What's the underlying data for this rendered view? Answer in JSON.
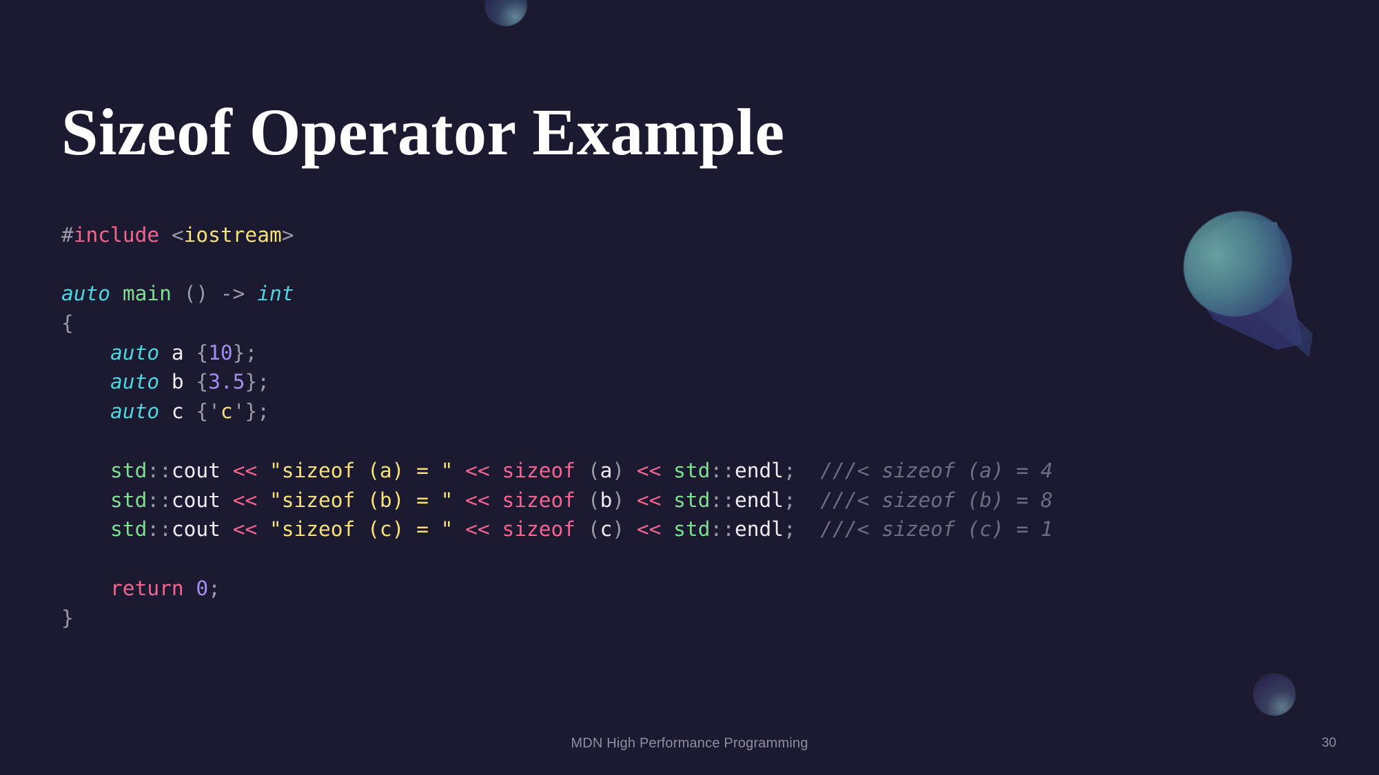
{
  "slide": {
    "title": "Sizeof Operator Example",
    "background_color": "#1c1a30",
    "footer": "MDN High Performance Programming",
    "page_number": "30"
  },
  "decorations": {
    "sphere_top": "sphere-decoration",
    "sphere_bottom": "sphere-decoration",
    "cone": "cone-decoration"
  },
  "code": {
    "language": "cpp",
    "lines": {
      "l1": {
        "hash": "#",
        "include": "include",
        "space": " ",
        "lt": "<",
        "header": "iostream",
        "gt": ">"
      },
      "l2_blank": "",
      "l3": {
        "auto": "auto",
        "sp1": " ",
        "main": "main",
        "sp2": " ",
        "parens": "()",
        "sp3": " ",
        "arrow": "->",
        "sp4": " ",
        "int": "int"
      },
      "l4": {
        "brace": "{"
      },
      "l5": {
        "indent": "    ",
        "auto": "auto",
        "sp1": " ",
        "name": "a",
        "sp2": " ",
        "open": "{",
        "value": "10",
        "close": "};"
      },
      "l6": {
        "indent": "    ",
        "auto": "auto",
        "sp1": " ",
        "name": "b",
        "sp2": " ",
        "open": "{",
        "value": "3.5",
        "close": "};"
      },
      "l7": {
        "indent": "    ",
        "auto": "auto",
        "sp1": " ",
        "name": "c",
        "sp2": " ",
        "open": "{'",
        "value": "c",
        "close": "'};"
      },
      "l8_blank": "",
      "l9": {
        "indent": "    ",
        "ns": "std",
        "scope": "::",
        "stream": "cout",
        "sp1": " ",
        "shift1": "<<",
        "sp2": " ",
        "string": "\"sizeof (a) = \"",
        "sp3": " ",
        "shift2": "<<",
        "sp4": " ",
        "sizeof": "sizeof",
        "sp5": " ",
        "open": "(",
        "arg": "a",
        "close": ")",
        "sp6": " ",
        "shift3": "<<",
        "sp7": " ",
        "ns2": "std",
        "scope2": "::",
        "endl": "endl",
        "semi": ";",
        "gap": "  ",
        "comment": "///< sizeof (a) = 4"
      },
      "l10": {
        "indent": "    ",
        "ns": "std",
        "scope": "::",
        "stream": "cout",
        "sp1": " ",
        "shift1": "<<",
        "sp2": " ",
        "string": "\"sizeof (b) = \"",
        "sp3": " ",
        "shift2": "<<",
        "sp4": " ",
        "sizeof": "sizeof",
        "sp5": " ",
        "open": "(",
        "arg": "b",
        "close": ")",
        "sp6": " ",
        "shift3": "<<",
        "sp7": " ",
        "ns2": "std",
        "scope2": "::",
        "endl": "endl",
        "semi": ";",
        "gap": "  ",
        "comment": "///< sizeof (b) = 8"
      },
      "l11": {
        "indent": "    ",
        "ns": "std",
        "scope": "::",
        "stream": "cout",
        "sp1": " ",
        "shift1": "<<",
        "sp2": " ",
        "string": "\"sizeof (c) = \"",
        "sp3": " ",
        "shift2": "<<",
        "sp4": " ",
        "sizeof": "sizeof",
        "sp5": " ",
        "open": "(",
        "arg": "c",
        "close": ")",
        "sp6": " ",
        "shift3": "<<",
        "sp7": " ",
        "ns2": "std",
        "scope2": "::",
        "endl": "endl",
        "semi": ";",
        "gap": "  ",
        "comment": "///< sizeof (c) = 1"
      },
      "l12_blank": "",
      "l13": {
        "indent": "    ",
        "return": "return",
        "sp1": " ",
        "value": "0",
        "semi": ";"
      },
      "l14": {
        "brace": "}"
      }
    }
  },
  "colors": {
    "background": "#1c1a30",
    "title": "#ffffff",
    "keyword": "#f4658f",
    "type": "#4fd6e0",
    "string": "#f6e27a",
    "number": "#a48df0",
    "function": "#7fdf92",
    "punctuation": "#9a9aa8",
    "comment": "#6e6e82",
    "footer": "#8e8ea2"
  }
}
